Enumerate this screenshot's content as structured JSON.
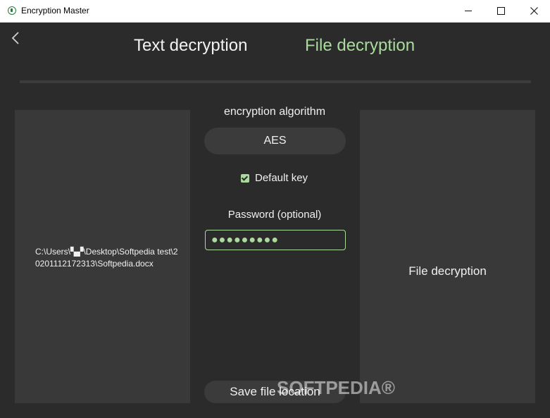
{
  "window": {
    "title": "Encryption Master"
  },
  "nav": {
    "back_icon": "chevron-left-icon"
  },
  "tabs": [
    {
      "label": "Text decryption",
      "active": false
    },
    {
      "label": "File decryption",
      "active": true
    }
  ],
  "colors": {
    "accent": "#a9dc9c",
    "background": "#2b2b2b",
    "panel": "#393939"
  },
  "left_panel": {
    "file_path": "C:\\Users\\▚▞\\Desktop\\Softpedia test\\20201112172313\\Softpedia.docx"
  },
  "form": {
    "algorithm_label": "encryption algorithm",
    "algorithm_value": "AES",
    "default_key_label": "Default key",
    "default_key_checked": true,
    "password_label": "Password (optional)",
    "password_value": "●●●●●●●●●",
    "save_label": "Save file location"
  },
  "right_panel": {
    "label": "File decryption"
  },
  "watermark": "SOFTPEDIA®"
}
